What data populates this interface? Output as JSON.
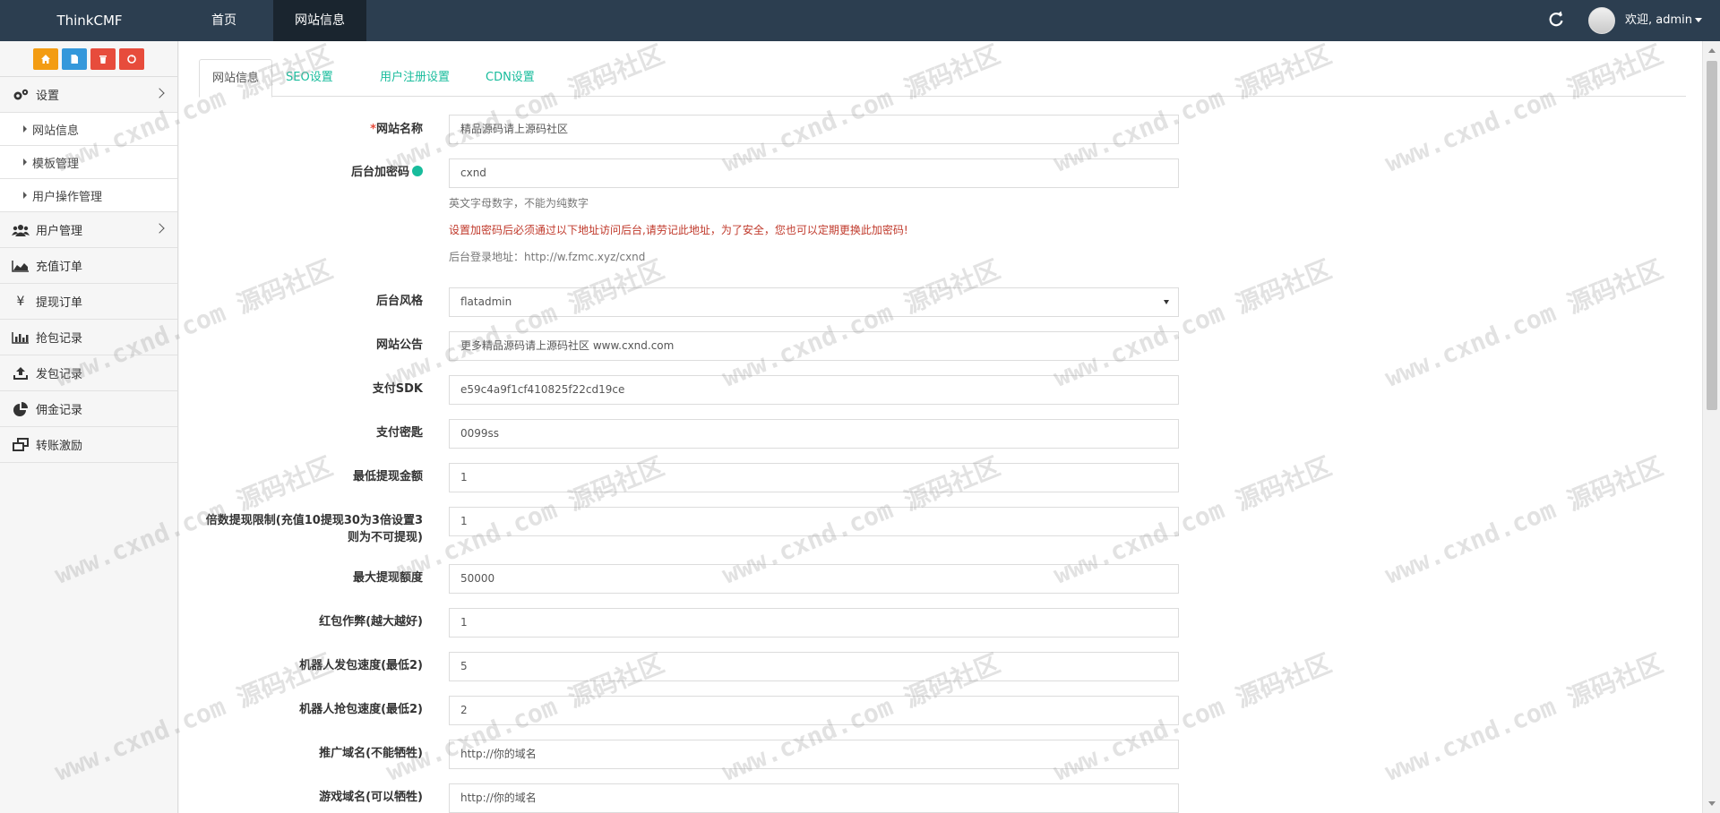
{
  "navbar": {
    "brand": "ThinkCMF",
    "links": [
      "首页",
      "网站信息"
    ],
    "user_greeting": "欢迎, admin"
  },
  "sidebar": {
    "shortcuts": [
      {
        "icon": "home-icon",
        "color": "#f39c12"
      },
      {
        "icon": "file-icon",
        "color": "#3498db"
      },
      {
        "icon": "trash-icon",
        "color": "#e74c3c"
      },
      {
        "icon": "recycle-icon",
        "color": "#e74c3c"
      }
    ],
    "settings_label": "设置",
    "sub_items": [
      "网站信息",
      "模板管理",
      "用户操作管理"
    ],
    "items": [
      {
        "label": "用户管理",
        "icon": "users-icon"
      },
      {
        "label": "充值订单",
        "icon": "area-chart-icon"
      },
      {
        "label": "提现订单",
        "icon": "yen-icon"
      },
      {
        "label": "抢包记录",
        "icon": "bar-chart-icon"
      },
      {
        "label": "发包记录",
        "icon": "upload-icon"
      },
      {
        "label": "佣金记录",
        "icon": "pie-chart-icon"
      },
      {
        "label": "转账激励",
        "icon": "windows-icon"
      }
    ]
  },
  "tabs": [
    "网站信息",
    "SEO设置",
    "用户注册设置",
    "CDN设置"
  ],
  "form": {
    "site_name": {
      "label": "网站名称",
      "value": "精品源码请上源码社区"
    },
    "admin_code": {
      "label": "后台加密码",
      "value": "cxnd",
      "help1": "英文字母数字，不能为纯数字",
      "help2": "设置加密码后必须通过以下地址访问后台,请劳记此地址，为了安全，您也可以定期更换此加密码!",
      "help3_label": "后台登录地址：",
      "help3_url": "http://w.fzmc.xyz/cxnd"
    },
    "admin_style": {
      "label": "后台风格",
      "value": "flatadmin"
    },
    "notice": {
      "label": "网站公告",
      "value": "更多精品源码请上源码社区 www.cxnd.com"
    },
    "pay_sdk": {
      "label": "支付SDK",
      "value": "e59c4a9f1cf410825f22cd19ce"
    },
    "pay_key": {
      "label": "支付密匙",
      "value": "0099ss"
    },
    "min_withdraw": {
      "label": "最低提现金额",
      "value": "1"
    },
    "multiple_limit": {
      "label_line1": "倍数提现限制(充值10提现30为3倍设置3",
      "label_line2": "则为不可提现)",
      "value": "1"
    },
    "max_withdraw": {
      "label": "最大提现额度",
      "value": "50000"
    },
    "cheat": {
      "label": "红包作弊(越大越好)",
      "value": "1"
    },
    "robot_send": {
      "label": "机器人发包速度(最低2)",
      "value": "5"
    },
    "robot_grab": {
      "label": "机器人抢包速度(最低2)",
      "value": "2"
    },
    "promo_domain": {
      "label": "推广域名(不能牺牲)",
      "value": "http://你的域名"
    },
    "game_domain": {
      "label": "游戏域名(可以牺牲)",
      "value": "http://你的域名"
    }
  },
  "watermark": {
    "text": "www.cxnd.com 源码社区"
  }
}
